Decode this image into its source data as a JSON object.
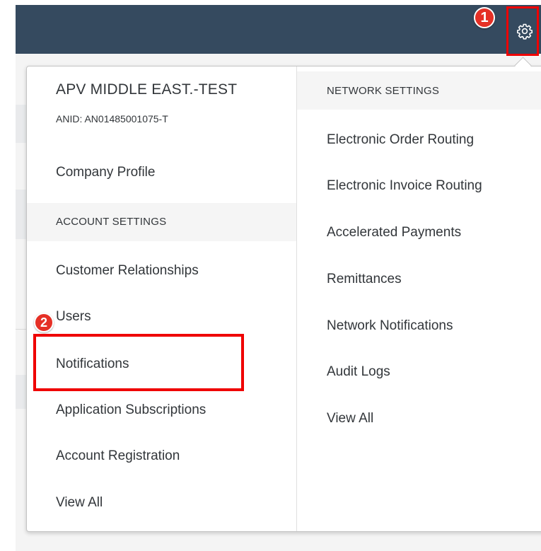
{
  "header": {
    "step_1_label": "1",
    "settings_icon": "gear-icon"
  },
  "account_menu": {
    "company_name": "APV MIDDLE EAST.-TEST",
    "anid": "ANID: AN01485001075-T",
    "company_profile": "Company Profile",
    "section_title": "ACCOUNT SETTINGS",
    "items": [
      "Customer Relationships",
      "Users",
      "Notifications",
      "Application Subscriptions",
      "Account Registration",
      "View All"
    ],
    "step_2_label": "2"
  },
  "network_menu": {
    "section_title": "NETWORK SETTINGS",
    "items": [
      "Electronic Order Routing",
      "Electronic Invoice Routing",
      "Accelerated Payments",
      "Remittances",
      "Network Notifications",
      "Audit Logs",
      "View All"
    ]
  },
  "colors": {
    "header_bg": "#354a5f",
    "highlight": "#ef0000",
    "marker": "#e53026",
    "text": "#32363a"
  }
}
